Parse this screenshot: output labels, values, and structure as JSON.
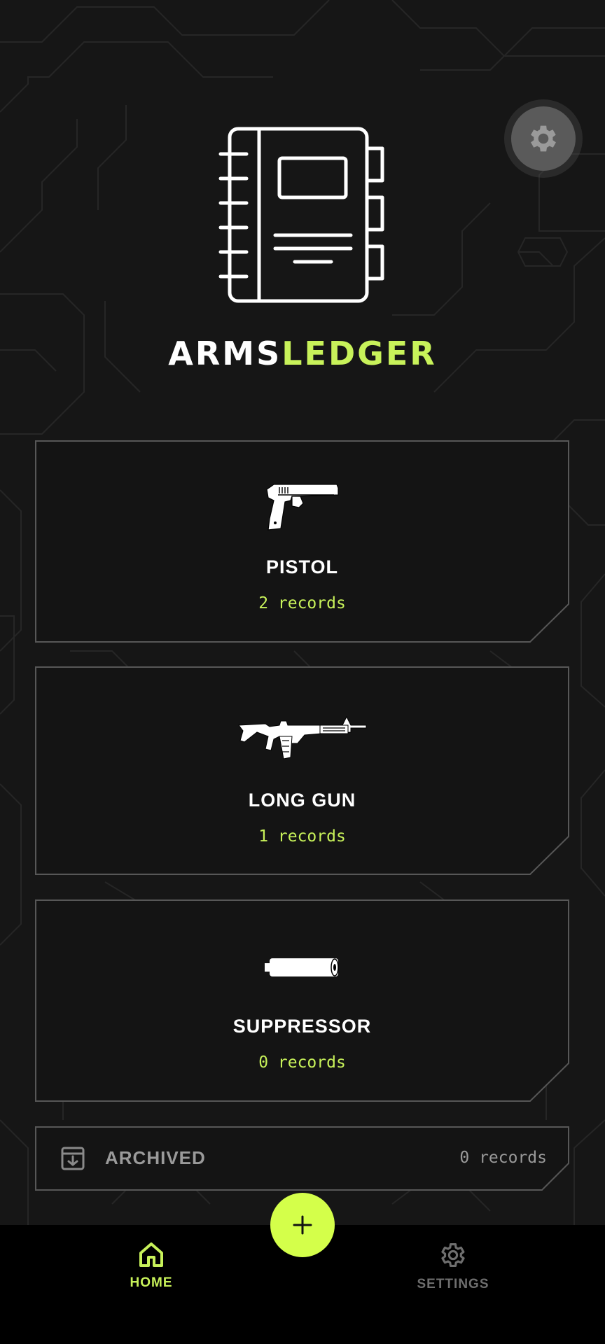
{
  "app": {
    "title_part1": "ARMS",
    "title_part2": "LEDGER",
    "accent_color": "#c8f25a"
  },
  "header": {
    "settings_icon": "gear-icon",
    "logo_icon": "notebook-icon"
  },
  "categories": [
    {
      "icon": "pistol-icon",
      "title": "PISTOL",
      "count": "2 records"
    },
    {
      "icon": "rifle-icon",
      "title": "LONG GUN",
      "count": "1 records"
    },
    {
      "icon": "suppressor-icon",
      "title": "SUPPRESSOR",
      "count": "0 records"
    }
  ],
  "archived": {
    "icon": "archive-icon",
    "label": "ARCHIVED",
    "count": "0 records"
  },
  "fab": {
    "icon": "plus-icon"
  },
  "bottom_nav": {
    "items": [
      {
        "icon": "home-icon",
        "label": "HOME",
        "active": true
      },
      {
        "icon": "gear-icon",
        "label": "SETTINGS",
        "active": false
      }
    ]
  }
}
